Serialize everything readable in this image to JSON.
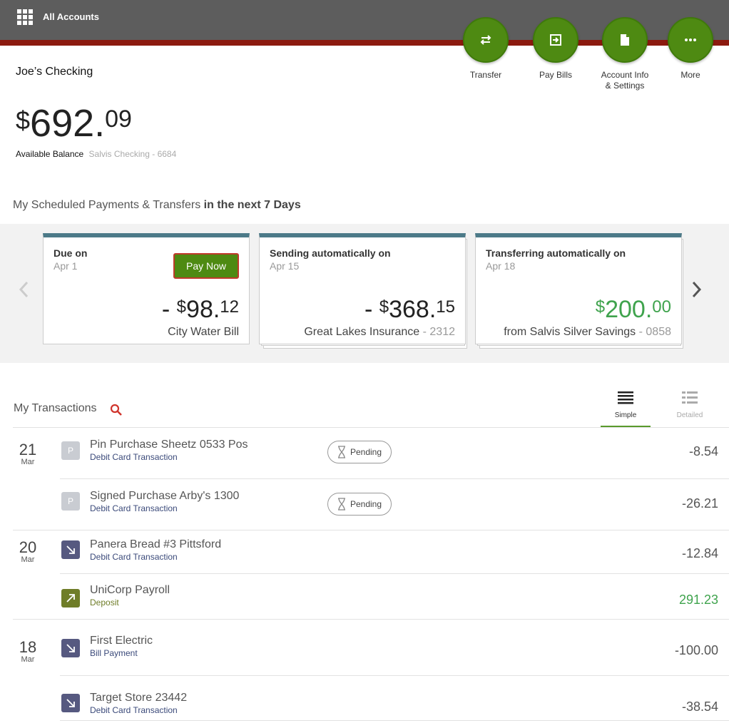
{
  "header": {
    "all_accounts": "All Accounts",
    "actions": [
      {
        "label": "Transfer",
        "icon": "transfer-icon"
      },
      {
        "label": "Pay Bills",
        "icon": "pay-bills-icon"
      },
      {
        "label": "Account Info\n& Settings",
        "icon": "document-icon"
      },
      {
        "label": "More",
        "icon": "more-dots-icon"
      }
    ]
  },
  "account": {
    "name": "Joe’s Checking",
    "balance_currency": "$",
    "balance_whole": "692.",
    "balance_cents": "09",
    "balance_label": "Available Balance",
    "account_ref": "Salvis Checking - 6684"
  },
  "scheduled": {
    "title_main": "My Scheduled Payments & Transfers ",
    "title_bold": "in the next 7 Days",
    "cards": [
      {
        "title": "Due on",
        "date": "Apr 1",
        "button": "Pay Now",
        "sign": "- ",
        "currency": "$",
        "whole": "98.",
        "cents": "12",
        "payee": "City Water Bill",
        "payee_suffix": ""
      },
      {
        "title": "Sending automatically on",
        "date": "Apr 15",
        "sign": "- ",
        "currency": "$",
        "whole": "368.",
        "cents": "15",
        "payee": "Great Lakes Insurance",
        "payee_suffix": " - 2312"
      },
      {
        "title": "Transferring automatically on",
        "date": "Apr 18",
        "sign": "",
        "currency": "$",
        "whole": "200.",
        "cents": "00",
        "payee": "from Salvis Silver Savings",
        "payee_suffix": " - 0858"
      }
    ]
  },
  "transactions": {
    "title": "My Transactions",
    "views": {
      "simple": "Simple",
      "detailed": "Detailed"
    },
    "pending_label": "Pending",
    "rows": [
      {
        "day": "21",
        "month": "Mar",
        "icon_letter": "P",
        "name": "Pin Purchase Sheetz 0533 Pos",
        "type": "Debit Card Transaction",
        "pending": true,
        "amount": "-8.54"
      },
      {
        "day": "",
        "month": "",
        "icon_letter": "P",
        "name": "Signed Purchase Arby's 1300",
        "type": "Debit Card Transaction",
        "pending": true,
        "amount": "-26.21"
      },
      {
        "day": "20",
        "month": "Mar",
        "icon_letter": "",
        "name": "Panera Bread #3 Pittsford",
        "type": "Debit Card Transaction",
        "pending": false,
        "amount": "-12.84"
      },
      {
        "day": "",
        "month": "",
        "icon_letter": "",
        "name": "UniCorp Payroll",
        "type": "Deposit",
        "pending": false,
        "amount": "291.23"
      },
      {
        "day": "18",
        "month": "Mar",
        "icon_letter": "",
        "name": "First Electric",
        "type": "Bill Payment",
        "pending": false,
        "amount": "-100.00"
      },
      {
        "day": "",
        "month": "",
        "icon_letter": "",
        "name": "Target Store 23442",
        "type": "Debit Card Transaction",
        "pending": false,
        "amount": "-38.54"
      }
    ]
  },
  "colors": {
    "action_green": "#4e8a12",
    "card_top": "#4c7a88",
    "positive": "#3fa34d",
    "header_gray": "#5d5d5d",
    "header_red": "#8c1a0f"
  }
}
